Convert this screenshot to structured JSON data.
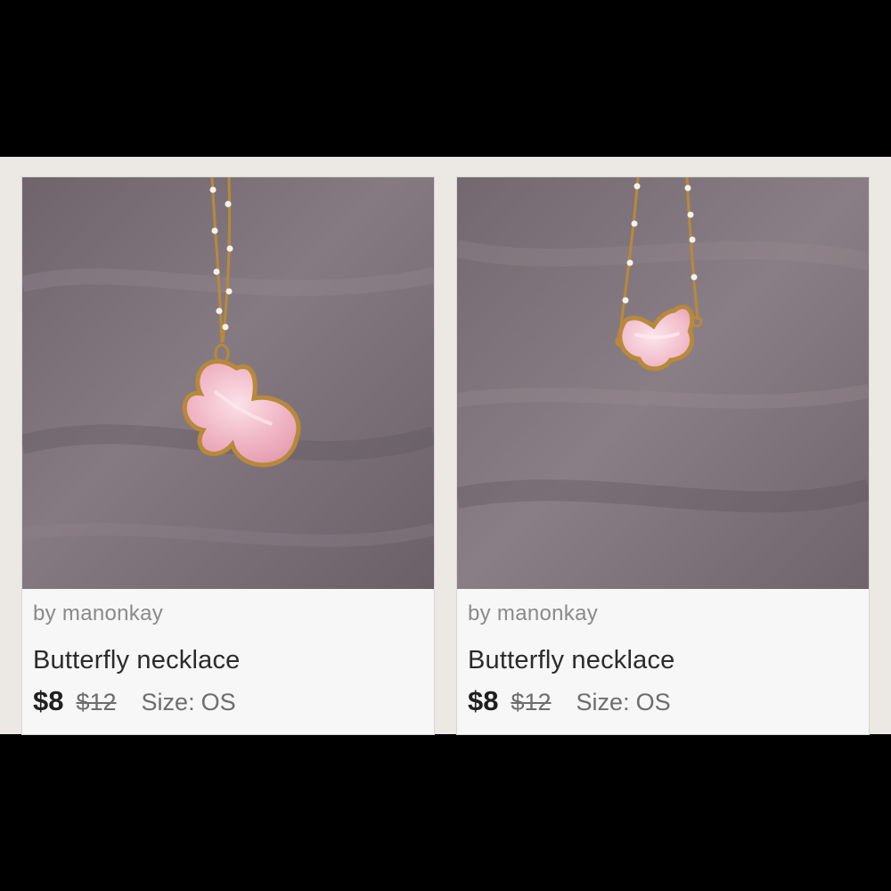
{
  "listings": [
    {
      "seller": "by manonkay",
      "title": "Butterfly necklace",
      "price": "$8",
      "original_price": "$12",
      "size_label": "Size:",
      "size_value": "OS"
    },
    {
      "seller": "by manonkay",
      "title": "Butterfly necklace",
      "price": "$8",
      "original_price": "$12",
      "size_label": "Size:",
      "size_value": "OS"
    }
  ],
  "colors": {
    "page_background": "#000000",
    "band_background": "#ece9e4",
    "fabric": "#7a6e77",
    "pendant_pink": "#f2b8c8",
    "gold": "#b8893a"
  }
}
